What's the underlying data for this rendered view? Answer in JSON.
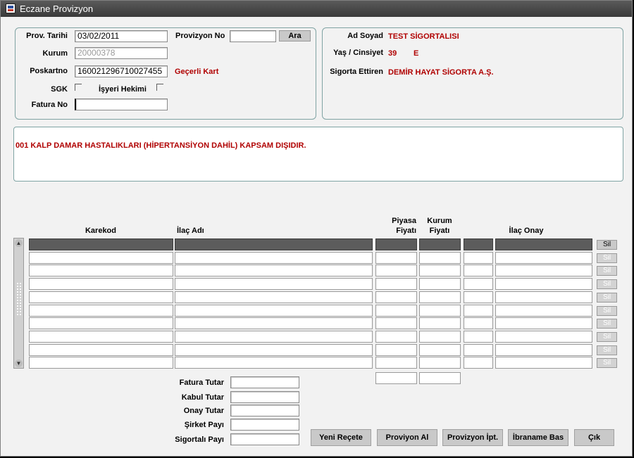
{
  "window": {
    "title": "Eczane Provizyon"
  },
  "form": {
    "prov_tarihi_label": "Prov. Tarihi",
    "prov_tarihi_value": "03/02/2011",
    "provizyon_no_label": "Provizyon No",
    "provizyon_no_value": "",
    "ara_button": "Ara",
    "kurum_label": "Kurum",
    "kurum_value": "20000378",
    "poskartno_label": "Poskartno",
    "poskartno_value": "160021296710027455",
    "kart_status": "Geçerli Kart",
    "sgk_label": "SGK",
    "isyeri_label": "İşyeri Hekimi",
    "fatura_no_label": "Fatura No",
    "fatura_no_value": ""
  },
  "insured": {
    "ad_soyad_label": "Ad Soyad",
    "ad_soyad_value": "TEST SİGORTALISI",
    "yas_label": "Yaş / Cinsiyet",
    "yas_value": "39",
    "cinsiyet_value": "E",
    "sigorta_ettiren_label": "Sigorta Ettiren",
    "sigorta_ettiren_value": "DEMİR HAYAT SİGORTA A.Ş."
  },
  "message": "001 KALP DAMAR HASTALIKLARI (HİPERTANSİYON DAHİL) KAPSAM DIŞIDIR.",
  "grid": {
    "headers": {
      "karekod": "Karekod",
      "ilac_adi": "İlaç Adı",
      "piyasa_1": "Piyasa",
      "piyasa_2": "Fiyatı",
      "kurum_1": "Kurum",
      "kurum_2": "Fiyatı",
      "ilac_onay": "İlaç Onay"
    },
    "row_count": 10,
    "delete_label": "Sil"
  },
  "totals": {
    "fatura_tutar_label": "Fatura Tutar",
    "kabul_tutar_label": "Kabul Tutar",
    "onay_tutar_label": "Onay Tutar",
    "sirket_payi_label": "Şirket Payı",
    "sigortali_payi_label": "Sigortalı Payı"
  },
  "buttons": {
    "yeni_recete": "Yeni Reçete",
    "provizyon_al": "Proviyon Al",
    "provizyon_ipt": "Provizyon İpt.",
    "ibraname_bas": "İbraname Bas",
    "cik": "Çık"
  }
}
